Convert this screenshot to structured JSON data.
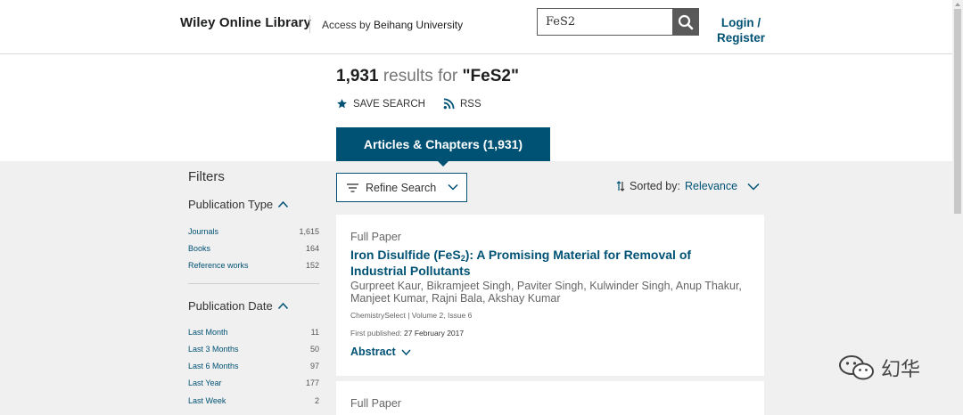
{
  "header": {
    "logo": "Wiley Online Library",
    "access_prefix": "Access by",
    "access_institution": "Beihang University",
    "search_value": "FeS2",
    "login_line1": "Login /",
    "login_line2": "Register"
  },
  "results": {
    "count": "1,931",
    "middle": "results for",
    "query": "\"FeS2\"",
    "save_search": "SAVE SEARCH",
    "rss": "RSS"
  },
  "tab": {
    "label": "Articles & Chapters (1,931)"
  },
  "filters": {
    "title": "Filters",
    "publication_type": {
      "title": "Publication Type",
      "items": [
        {
          "label": "Journals",
          "count": "1,615"
        },
        {
          "label": "Books",
          "count": "164"
        },
        {
          "label": "Reference works",
          "count": "152"
        }
      ]
    },
    "publication_date": {
      "title": "Publication Date",
      "items": [
        {
          "label": "Last Month",
          "count": "11"
        },
        {
          "label": "Last 3 Months",
          "count": "50"
        },
        {
          "label": "Last 6 Months",
          "count": "97"
        },
        {
          "label": "Last Year",
          "count": "177"
        },
        {
          "label": "Last Week",
          "count": "2"
        }
      ]
    }
  },
  "refine": {
    "label": "Refine Search"
  },
  "sort": {
    "label": "Sorted by:",
    "value": "Relevance"
  },
  "cards": [
    {
      "type": "Full Paper",
      "title_pre": "Iron Disulfide (FeS",
      "title_sub": "2",
      "title_post": "): A Promising Material for Removal of Industrial Pollutants",
      "authors": "Gurpreet Kaur, Bikramjeet Singh, Paviter Singh, Kulwinder Singh, Anup Thakur, Manjeet Kumar, Rajni Bala, Akshay Kumar",
      "journal": "ChemistrySelect | Volume 2, Issue 6",
      "published_label": "First published:",
      "published_date": "27 February 2017",
      "abstract": "Abstract"
    },
    {
      "type": "Full Paper"
    }
  ],
  "watermark": {
    "text": "幻华"
  }
}
